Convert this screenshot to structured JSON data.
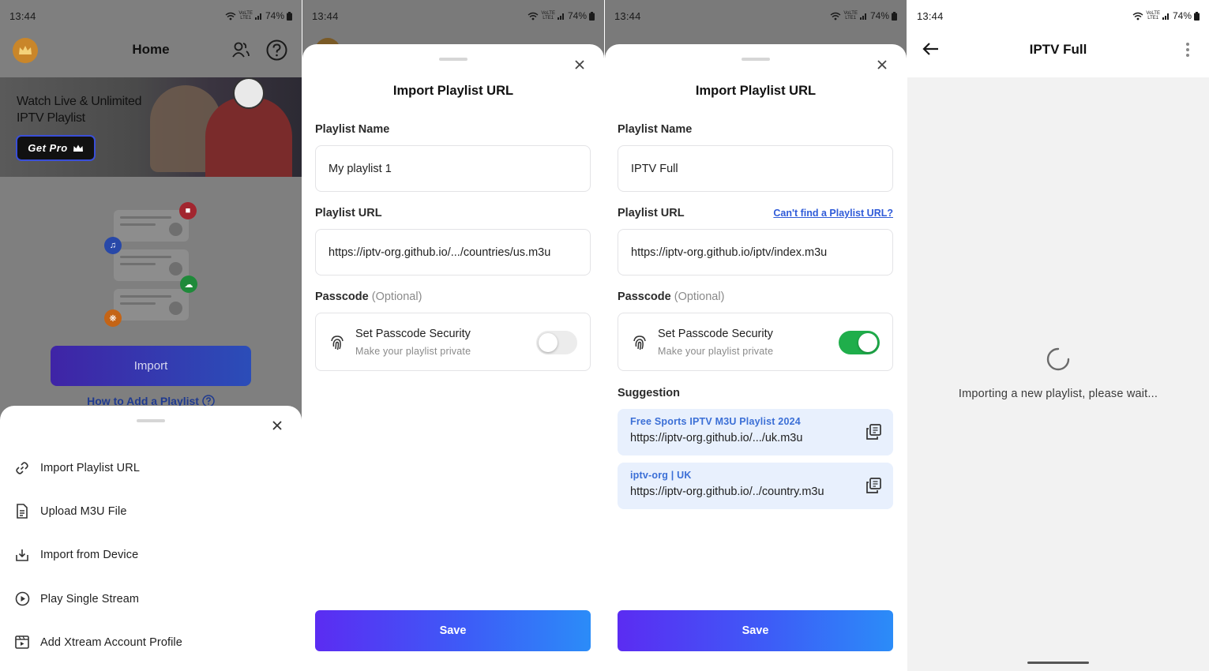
{
  "status": {
    "time": "13:44",
    "battery": "74%",
    "volte_top": "VoLTE",
    "volte_bottom": "LTE1"
  },
  "home": {
    "title": "Home",
    "banner_title": "Watch Live & Unlimited IPTV Playlist",
    "get_pro": "Get Pro",
    "import_label": "Import",
    "how_to": "How to Add a Playlist",
    "menu": [
      {
        "icon": "link-icon",
        "label": "Import Playlist URL"
      },
      {
        "icon": "file-icon",
        "label": "Upload M3U File"
      },
      {
        "icon": "download-icon",
        "label": "Import from Device"
      },
      {
        "icon": "play-circle-icon",
        "label": "Play Single Stream"
      },
      {
        "icon": "xtream-icon",
        "label": "Add Xtream Account Profile"
      }
    ]
  },
  "import_modal_a": {
    "title": "Import Playlist URL",
    "name_label": "Playlist Name",
    "name_value": "My playlist 1",
    "url_label": "Playlist URL",
    "url_value": "https://iptv-org.github.io/.../countries/us.m3u",
    "passcode_label": "Passcode",
    "optional": "(Optional)",
    "passcode_title": "Set Passcode Security",
    "passcode_sub": "Make your playlist private",
    "passcode_enabled": false,
    "save": "Save"
  },
  "import_modal_b": {
    "title": "Import Playlist URL",
    "name_label": "Playlist Name",
    "name_value": "IPTV Full",
    "url_label": "Playlist URL",
    "cant_find": "Can't find a Playlist URL?",
    "url_value": "https://iptv-org.github.io/iptv/index.m3u",
    "passcode_label": "Passcode",
    "optional": "(Optional)",
    "passcode_title": "Set Passcode Security",
    "passcode_sub": "Make your playlist private",
    "passcode_enabled": true,
    "suggestion_label": "Suggestion",
    "suggestions": [
      {
        "title": "Free Sports IPTV M3U Playlist 2024",
        "url": "https://iptv-org.github.io/.../uk.m3u"
      },
      {
        "title": "iptv-org | UK",
        "url": "https://iptv-org.github.io/../country.m3u"
      }
    ],
    "save": "Save"
  },
  "loading": {
    "title": "IPTV Full",
    "message": "Importing a new playlist, please wait..."
  },
  "colors": {
    "accent_blue": "#2f5bd8",
    "toggle_on": "#1fae4b",
    "save_gradient_start": "#5b2cf2",
    "save_gradient_end": "#2b8cf8",
    "suggestion_bg": "#e8f0fd"
  }
}
